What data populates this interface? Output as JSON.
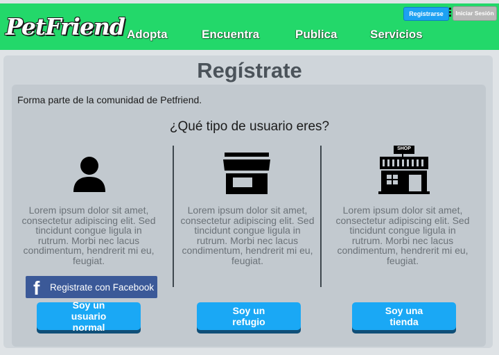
{
  "nav": {
    "logo": "PetFriend",
    "items": [
      "Adopta",
      "Encuentra",
      "Publica",
      "Servicios"
    ],
    "register_label": "Registrarse",
    "login_label": "Iniciar Sesión"
  },
  "page": {
    "title": "Regístrate",
    "intro": "Forma parte de la comunidad de Petfriend.",
    "question": "¿Qué tipo de usuario eres?"
  },
  "columns": [
    {
      "icon": "user-icon",
      "text": "Lorem ipsum dolor sit amet, consectetur adipiscing elit. Sed tincidunt congue ligula in rutrum. Morbi nec lacus condimentum, hendrerit mi eu, feugiat.",
      "button": "Soy un usuario normal"
    },
    {
      "icon": "store-icon",
      "text": "Lorem ipsum dolor sit amet, consectetur adipiscing elit. Sed tincidunt congue ligula in rutrum. Morbi nec lacus condimentum, hendrerit mi eu, feugiat.",
      "button": "Soy un refugio"
    },
    {
      "icon": "shop-icon",
      "shop_sign": "SHOP",
      "text": "Lorem ipsum dolor sit amet, consectetur adipiscing elit. Sed tincidunt congue ligula in rutrum. Morbi nec lacus condimentum, hendrerit mi eu, feugiat.",
      "button": "Soy una tienda"
    }
  ],
  "facebook": {
    "icon": "facebook-icon",
    "letter": "f",
    "label": "Registrate con Facebook"
  },
  "colors": {
    "nav": "#23d86a",
    "cta": "#1aa8f5",
    "facebook": "#3b5998"
  }
}
